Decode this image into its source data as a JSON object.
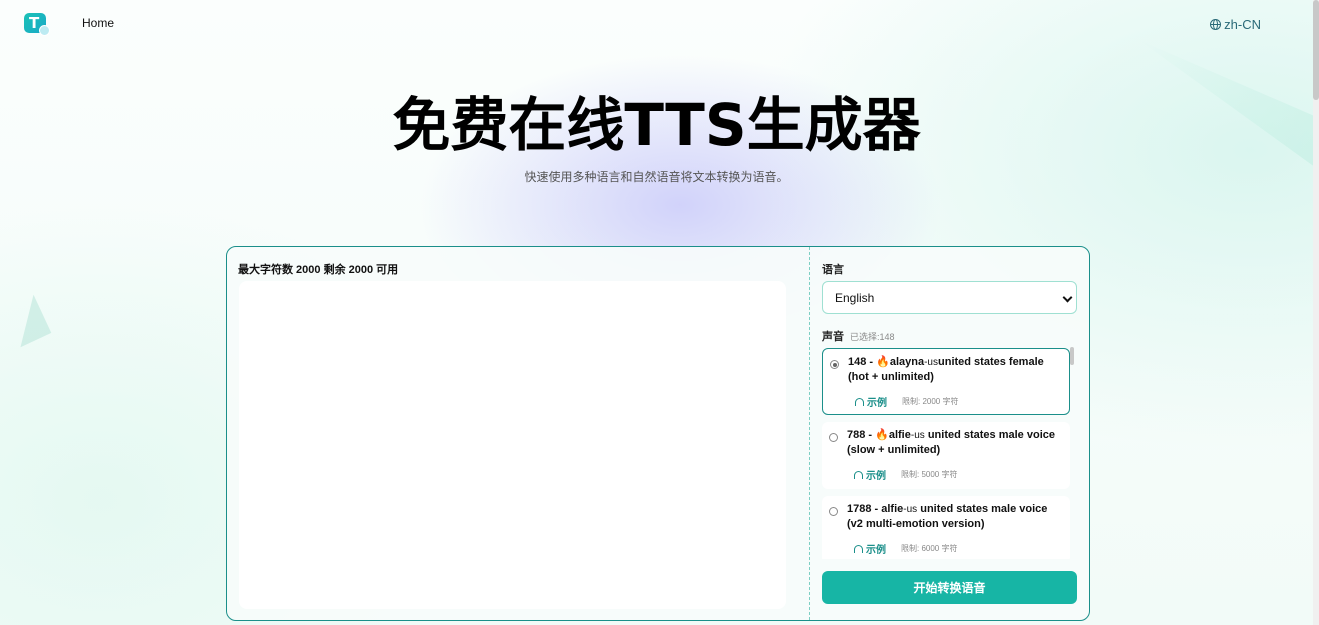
{
  "header": {
    "logo_icon": "tts-logo-icon",
    "nav_home": "Home",
    "language_icon": "globe-icon",
    "language_label": "zh-CN"
  },
  "hero": {
    "title": "免费在线TTS生成器",
    "subtitle": "快速使用多种语言和自然语音将文本转换为语音。"
  },
  "editor": {
    "char_info": "最大字符数 2000 剩余 2000 可用",
    "text_value": ""
  },
  "settings": {
    "language_label": "语言",
    "language_selected": "English",
    "voice_label": "声音",
    "voice_selected_count": "已选择:148",
    "voices": [
      {
        "id": "148",
        "fire": "🔥",
        "pre": "148 - ",
        "name": "alayna",
        "lang": "-us",
        "desc": "united states female (hot + unlimited)",
        "sample_label": "示例",
        "limit": "限制: 2000 字符",
        "selected": true
      },
      {
        "id": "788",
        "fire": "🔥",
        "pre": "788 - ",
        "name": "alfie",
        "lang": "-us",
        "desc": " united states male voice (slow + unlimited)",
        "sample_label": "示例",
        "limit": "限制: 5000 字符",
        "selected": false
      },
      {
        "id": "1788",
        "fire": "",
        "pre": "1788 - ",
        "name": "alfie",
        "lang": "-us",
        "desc": " united states male voice (v2 multi-emotion version)",
        "sample_label": "示例",
        "limit": "限制: 6000 字符",
        "selected": false
      }
    ],
    "convert_button": "开始转换语音"
  },
  "colors": {
    "accent": "#17b5a5",
    "border": "#1b8f8a",
    "fire": "#e8890f"
  }
}
